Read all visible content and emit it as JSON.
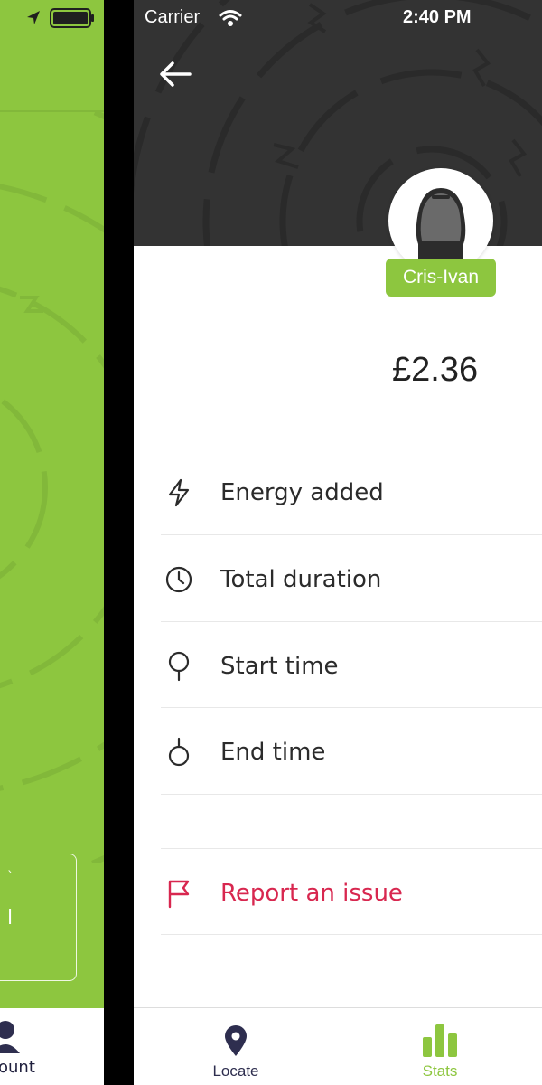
{
  "colors": {
    "brand_green": "#8dc63f",
    "header_dark": "#333333",
    "danger_red": "#d8274f",
    "nav_dark": "#2e2e4f"
  },
  "background_screen": {
    "tab_label_partial": "ount",
    "card_text_a": "`",
    "card_text_b": "l"
  },
  "status_bar": {
    "carrier": "Carrier",
    "time": "2:40 PM"
  },
  "header": {
    "back_icon": "arrow-left-icon"
  },
  "profile": {
    "name": "Cris-Ivan"
  },
  "session": {
    "amount": "£2.36"
  },
  "details": [
    {
      "label": "Energy added",
      "icon": "lightning-icon"
    },
    {
      "label": "Total duration",
      "icon": "clock-icon"
    },
    {
      "label": "Start time",
      "icon": "location-pin-icon"
    },
    {
      "label": "End time",
      "icon": "stopwatch-icon"
    }
  ],
  "actions": {
    "report_label": "Report an issue",
    "report_icon": "flag-icon"
  },
  "tabbar": {
    "tabs": [
      {
        "label": "Locate",
        "icon": "map-pin-icon",
        "active": false
      },
      {
        "label": "Stats",
        "icon": "bar-chart-icon",
        "active": true
      }
    ]
  }
}
